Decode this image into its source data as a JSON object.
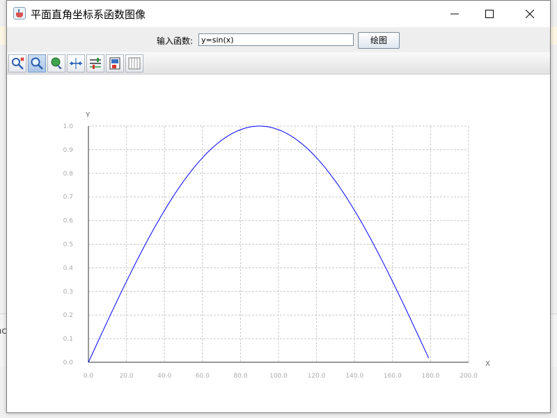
{
  "window": {
    "title": "平面直角坐标系函数图像"
  },
  "input_bar": {
    "label": "输入函数:",
    "function_value": "y=sin(x)",
    "plot_button_label": "绘图"
  },
  "toolbar": {
    "tools": [
      {
        "name": "zoom-reset-icon",
        "active": false
      },
      {
        "name": "zoom-icon",
        "active": true
      },
      {
        "name": "pan-icon",
        "active": false
      },
      {
        "name": "fit-icon",
        "active": false
      },
      {
        "name": "adjust-icon",
        "active": false
      },
      {
        "name": "save-image-icon",
        "active": false
      },
      {
        "name": "grid-icon",
        "active": false
      }
    ]
  },
  "background": {
    "peek_text": "nc"
  },
  "chart_data": {
    "type": "line",
    "title": "",
    "xlabel": "X",
    "ylabel": "Y",
    "xlim": [
      0.0,
      200.0
    ],
    "ylim": [
      0.0,
      1.0
    ],
    "x_ticks": [
      "0.0",
      "20.0",
      "40.0",
      "60.0",
      "80.0",
      "100.0",
      "120.0",
      "140.0",
      "160.0",
      "180.0",
      "200.0"
    ],
    "y_ticks": [
      "0.0",
      "0.1",
      "0.2",
      "0.3",
      "0.4",
      "0.5",
      "0.6",
      "0.7",
      "0.8",
      "0.9",
      "1.0"
    ],
    "grid": true,
    "line_color": "#0000ff",
    "series": [
      {
        "function": "y=sin(x)",
        "x": [
          0,
          10,
          20,
          30,
          40,
          50,
          60,
          70,
          80,
          90,
          100,
          110,
          120,
          130,
          140,
          150,
          160,
          170,
          179
        ],
        "y": [
          0.0,
          0.174,
          0.342,
          0.5,
          0.643,
          0.766,
          0.866,
          0.94,
          0.985,
          1.0,
          0.985,
          0.94,
          0.866,
          0.766,
          0.643,
          0.5,
          0.342,
          0.174,
          0.017
        ]
      }
    ]
  }
}
